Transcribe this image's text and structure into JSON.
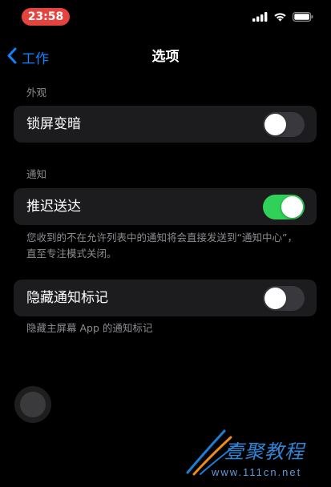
{
  "status_bar": {
    "time": "23:58",
    "time_pill_color": "#e5433e",
    "icons": [
      "cellular-signal-icon",
      "wifi-icon",
      "battery-icon"
    ]
  },
  "nav": {
    "back_label": "工作",
    "title": "选项",
    "accent_color": "#0a84ff"
  },
  "sections": {
    "appearance": {
      "header": "外观",
      "rows": [
        {
          "label": "锁屏变暗",
          "toggle_on": false
        }
      ]
    },
    "notifications": {
      "header": "通知",
      "rows": [
        {
          "label": "推迟送达",
          "toggle_on": true
        }
      ],
      "footnote": "您收到的不在允许列表中的通知将会直接发送到“通知中心”，直至专注模式关闭。"
    },
    "badges": {
      "rows": [
        {
          "label": "隐藏通知标记",
          "toggle_on": false
        }
      ],
      "footnote": "隐藏主屏幕 App 的通知标记"
    }
  },
  "colors": {
    "toggle_on": "#30d158",
    "toggle_off": "#39393d"
  },
  "watermark": {
    "title": "壹聚教程",
    "url": "www.111cn.net"
  }
}
